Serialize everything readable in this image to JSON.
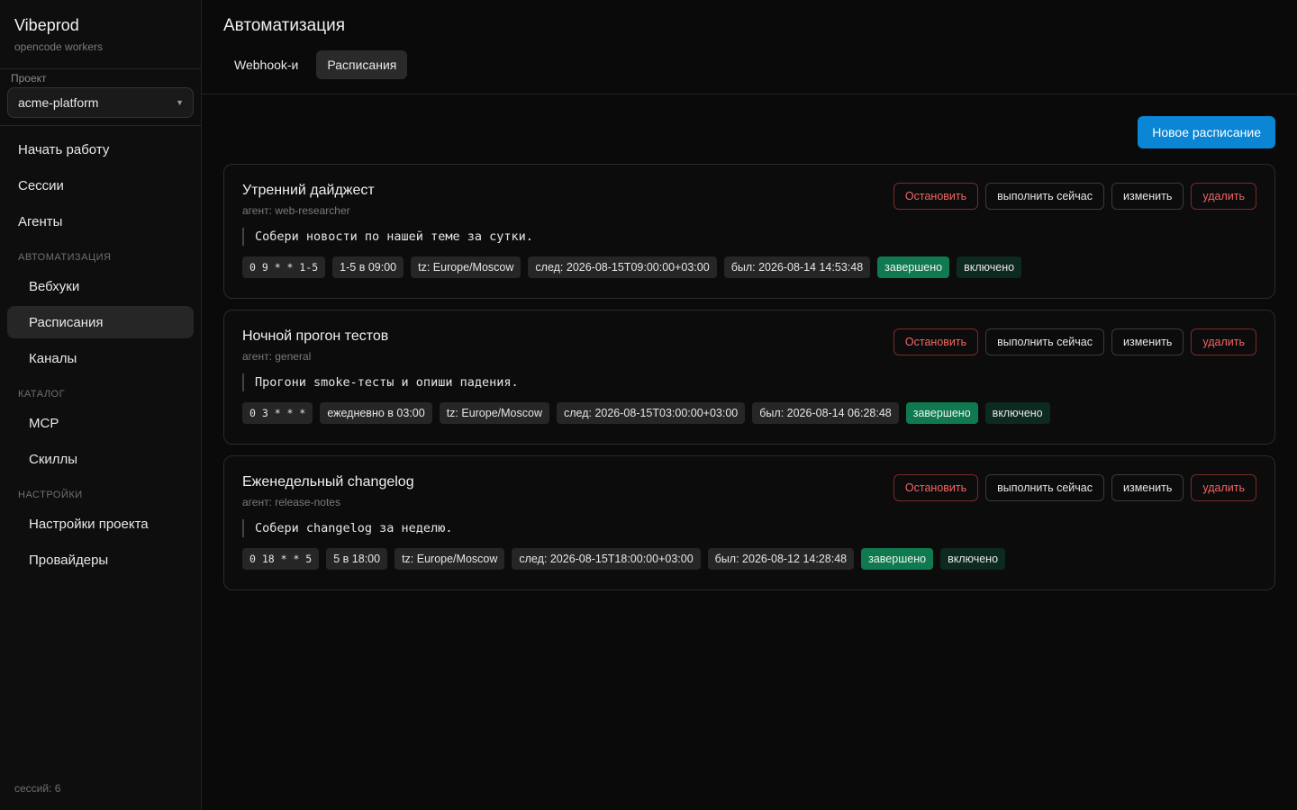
{
  "sidebar": {
    "brand_title": "Vibeprod",
    "brand_sub": "opencode workers",
    "project_label": "Проект",
    "project_value": "acme-platform",
    "nav_top": [
      "Начать работу",
      "Сессии",
      "Агенты"
    ],
    "section_automation": "АВТОМАТИЗАЦИЯ",
    "nav_automation": [
      "Вебхуки",
      "Расписания",
      "Каналы"
    ],
    "section_catalog": "КАТАЛОГ",
    "nav_catalog": [
      "MCP",
      "Скиллы"
    ],
    "section_settings": "НАСТРОЙКИ",
    "nav_settings": [
      "Настройки проекта",
      "Провайдеры"
    ],
    "footer": "сессий: 6"
  },
  "header": {
    "title": "Автоматизация",
    "tabs": [
      "Webhook-и",
      "Расписания"
    ]
  },
  "toolbar": {
    "new_schedule": "Новое расписание"
  },
  "actions": {
    "stop": "Остановить",
    "run_now": "выполнить сейчас",
    "edit": "изменить",
    "delete": "удалить"
  },
  "colors": {
    "primary": "#0b86d4",
    "danger": "#f26565",
    "status_done": "#0f7a4f",
    "enabled_bg": "#0d2a21"
  },
  "schedules": [
    {
      "title": "Утренний дайджест",
      "agent": "агент: web-researcher",
      "prompt": "Собери новости по нашей теме за сутки.",
      "cron": "0 9 * * 1-5",
      "human": "1-5 в 09:00",
      "tz": "tz: Europe/Moscow",
      "next": "след: 2026-08-15T09:00:00+03:00",
      "last": "был: 2026-08-14 14:53:48",
      "status": "завершено",
      "enabled": "включено"
    },
    {
      "title": "Ночной прогон тестов",
      "agent": "агент: general",
      "prompt": "Прогони smoke-тесты и опиши падения.",
      "cron": "0 3 * * *",
      "human": "ежедневно в 03:00",
      "tz": "tz: Europe/Moscow",
      "next": "след: 2026-08-15T03:00:00+03:00",
      "last": "был: 2026-08-14 06:28:48",
      "status": "завершено",
      "enabled": "включено"
    },
    {
      "title": "Еженедельный changelog",
      "agent": "агент: release-notes",
      "prompt": "Собери changelog за неделю.",
      "cron": "0 18 * * 5",
      "human": "5 в 18:00",
      "tz": "tz: Europe/Moscow",
      "next": "след: 2026-08-15T18:00:00+03:00",
      "last": "был: 2026-08-12 14:28:48",
      "status": "завершено",
      "enabled": "включено"
    }
  ]
}
